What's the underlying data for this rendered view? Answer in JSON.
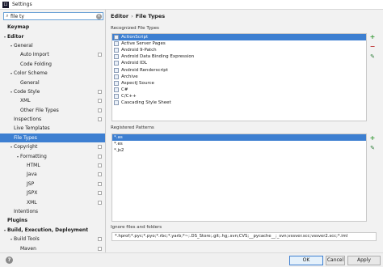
{
  "window": {
    "title": "Settings",
    "app_icon": "IJ"
  },
  "search": {
    "value": "file ty"
  },
  "tree": [
    {
      "label": "Keymap",
      "indent": 0,
      "bold": true,
      "arrow": "",
      "copy": false,
      "selected": false
    },
    {
      "label": "Editor",
      "indent": 0,
      "bold": true,
      "arrow": "▾",
      "copy": false,
      "selected": false
    },
    {
      "label": "General",
      "indent": 1,
      "bold": false,
      "arrow": "▾",
      "copy": false,
      "selected": false
    },
    {
      "label": "Auto Import",
      "indent": 2,
      "bold": false,
      "arrow": "",
      "copy": true,
      "selected": false
    },
    {
      "label": "Code Folding",
      "indent": 2,
      "bold": false,
      "arrow": "",
      "copy": false,
      "selected": false
    },
    {
      "label": "Color Scheme",
      "indent": 1,
      "bold": false,
      "arrow": "▾",
      "copy": false,
      "selected": false
    },
    {
      "label": "General",
      "indent": 2,
      "bold": false,
      "arrow": "",
      "copy": false,
      "selected": false
    },
    {
      "label": "Code Style",
      "indent": 1,
      "bold": false,
      "arrow": "▾",
      "copy": true,
      "selected": false
    },
    {
      "label": "XML",
      "indent": 2,
      "bold": false,
      "arrow": "",
      "copy": true,
      "selected": false
    },
    {
      "label": "Other File Types",
      "indent": 2,
      "bold": false,
      "arrow": "",
      "copy": true,
      "selected": false
    },
    {
      "label": "Inspections",
      "indent": 1,
      "bold": false,
      "arrow": "",
      "copy": true,
      "selected": false
    },
    {
      "label": "Live Templates",
      "indent": 1,
      "bold": false,
      "arrow": "",
      "copy": false,
      "selected": false
    },
    {
      "label": "File Types",
      "indent": 1,
      "bold": false,
      "arrow": "",
      "copy": false,
      "selected": true
    },
    {
      "label": "Copyright",
      "indent": 1,
      "bold": false,
      "arrow": "▾",
      "copy": true,
      "selected": false
    },
    {
      "label": "Formatting",
      "indent": 2,
      "bold": false,
      "arrow": "▾",
      "copy": true,
      "selected": false
    },
    {
      "label": "HTML",
      "indent": 3,
      "bold": false,
      "arrow": "",
      "copy": true,
      "selected": false
    },
    {
      "label": "Java",
      "indent": 3,
      "bold": false,
      "arrow": "",
      "copy": true,
      "selected": false
    },
    {
      "label": "JSP",
      "indent": 3,
      "bold": false,
      "arrow": "",
      "copy": true,
      "selected": false
    },
    {
      "label": "JSPX",
      "indent": 3,
      "bold": false,
      "arrow": "",
      "copy": true,
      "selected": false
    },
    {
      "label": "XML",
      "indent": 3,
      "bold": false,
      "arrow": "",
      "copy": true,
      "selected": false
    },
    {
      "label": "Intentions",
      "indent": 1,
      "bold": false,
      "arrow": "",
      "copy": false,
      "selected": false
    },
    {
      "label": "Plugins",
      "indent": 0,
      "bold": true,
      "arrow": "",
      "copy": false,
      "selected": false
    },
    {
      "label": "Build, Execution, Deployment",
      "indent": 0,
      "bold": true,
      "arrow": "▾",
      "copy": false,
      "selected": false
    },
    {
      "label": "Build Tools",
      "indent": 1,
      "bold": false,
      "arrow": "▾",
      "copy": true,
      "selected": false
    },
    {
      "label": "Maven",
      "indent": 2,
      "bold": false,
      "arrow": "",
      "copy": true,
      "selected": false
    }
  ],
  "breadcrumb": {
    "root": "Editor",
    "separator": "›",
    "current": "File Types"
  },
  "recognized": {
    "label": "Recognized File Types",
    "items": [
      {
        "label": "ActionScript",
        "selected": true,
        "icon": "actionscript-file-icon"
      },
      {
        "label": "Active Server Pages",
        "selected": false,
        "icon": "asp-file-icon"
      },
      {
        "label": "Android 9-Patch",
        "selected": false,
        "icon": "ninepatch-file-icon"
      },
      {
        "label": "Android Data Binding Expression",
        "selected": false,
        "icon": "databinding-file-icon"
      },
      {
        "label": "Android IDL",
        "selected": false,
        "icon": "aidl-file-icon"
      },
      {
        "label": "Android Renderscript",
        "selected": false,
        "icon": "renderscript-file-icon"
      },
      {
        "label": "Archive",
        "selected": false,
        "icon": "archive-file-icon"
      },
      {
        "label": "AspectJ Source",
        "selected": false,
        "icon": "aspectj-file-icon"
      },
      {
        "label": "C#",
        "selected": false,
        "icon": "csharp-file-icon"
      },
      {
        "label": "C/C++",
        "selected": false,
        "icon": "cpp-file-icon"
      },
      {
        "label": "Cascading Style Sheet",
        "selected": false,
        "icon": "css-file-icon"
      }
    ]
  },
  "patterns": {
    "label": "Registered Patterns",
    "items": [
      {
        "label": "*.as",
        "selected": true
      },
      {
        "label": "*.es",
        "selected": false
      },
      {
        "label": "*.js2",
        "selected": false
      }
    ]
  },
  "tools": {
    "add": "+",
    "remove": "−",
    "edit": "✎"
  },
  "ignore": {
    "label": "Ignore files and folders",
    "value": "*.hprof;*.pyc;*.pyo;*.rbc;*.yarb;*~;.DS_Store;.git;.hg;.svn;CVS;__pycache__;_svn;vssver.scc;vssver2.scc;*.iml"
  },
  "footer": {
    "help": "?",
    "ok": "OK",
    "cancel": "Cancel",
    "apply": "Apply"
  },
  "colors": {
    "selection": "#3d7fd1",
    "search_border": "#6aa1d6",
    "add": "#3a9b3a",
    "remove": "#c03a3a"
  }
}
